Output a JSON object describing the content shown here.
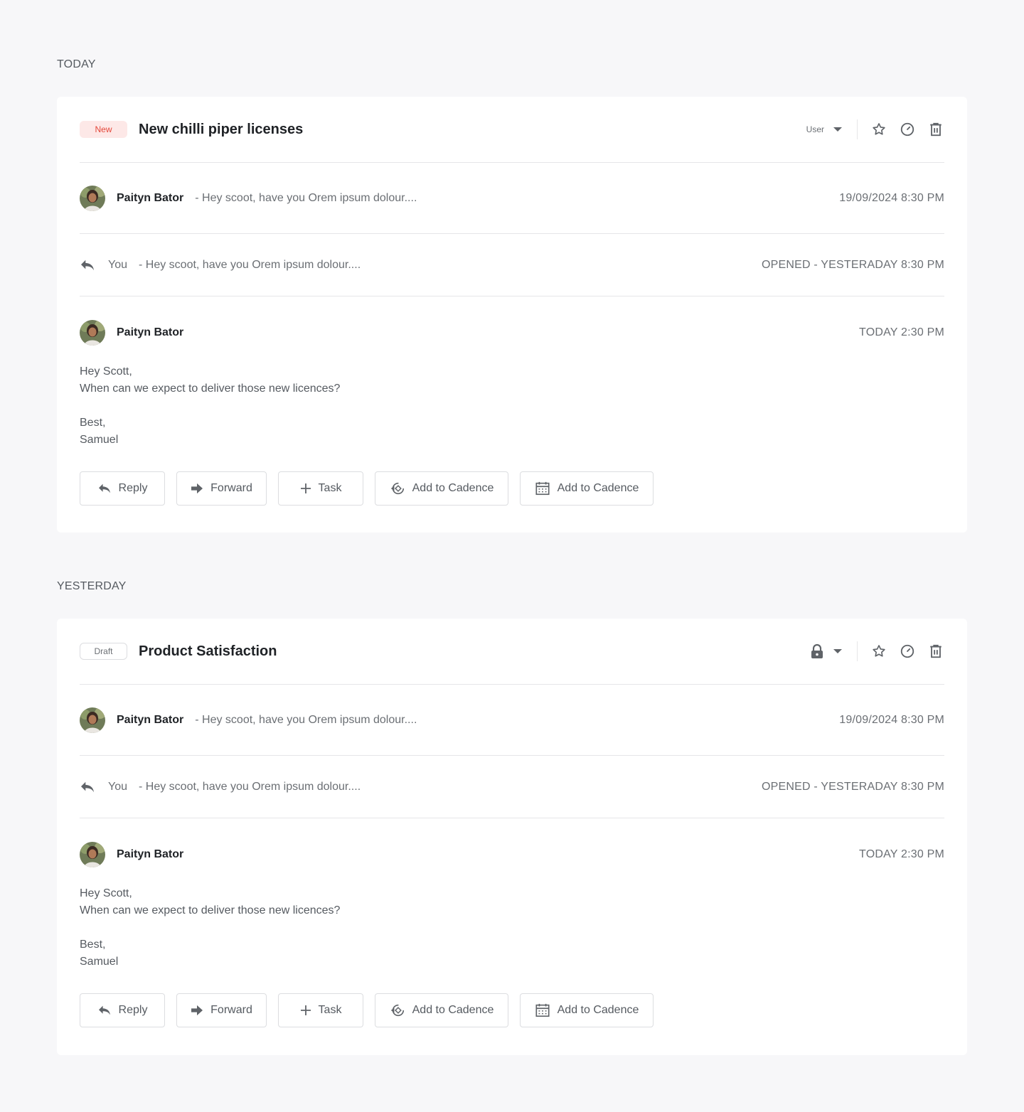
{
  "groups": [
    {
      "label": "TODAY",
      "thread": {
        "badge": "New",
        "title": "New chilli piper licenses",
        "owner_label": "User",
        "collapsed": {
          "sender": "Paityn Bator",
          "snippet": "- Hey scoot, have you Orem ipsum dolour....",
          "time": "19/09/2024 8:30 PM"
        },
        "reply": {
          "author": "You",
          "snippet": "- Hey scoot, have you Orem ipsum dolour....",
          "status": "OPENED - YESTERADAY 8:30 PM"
        },
        "open": {
          "sender": "Paityn Bator",
          "time": "TODAY 2:30 PM",
          "greeting": "Hey Scott,",
          "line": "When can we expect to deliver those new licences?",
          "signoff": "Best,",
          "signature": "Samuel"
        }
      }
    },
    {
      "label": "YESTERDAY",
      "thread": {
        "badge": "Draft",
        "title": "Product Satisfaction",
        "owner_label": "",
        "collapsed": {
          "sender": "Paityn Bator",
          "snippet": "- Hey scoot, have you Orem ipsum dolour....",
          "time": "19/09/2024 8:30 PM"
        },
        "reply": {
          "author": "You",
          "snippet": "- Hey scoot, have you Orem ipsum dolour....",
          "status": "OPENED - YESTERADAY 8:30 PM"
        },
        "open": {
          "sender": "Paityn Bator",
          "time": "TODAY 2:30 PM",
          "greeting": "Hey Scott,",
          "line": "When can we expect to deliver those new licences?",
          "signoff": "Best,",
          "signature": "Samuel"
        }
      }
    }
  ],
  "actions": {
    "reply": "Reply",
    "forward": "Forward",
    "task": "Task",
    "add_to_cadence_1": "Add to Cadence",
    "add_to_cadence_2": "Add to Cadence"
  },
  "icons": {
    "owner_caret": "caret-down-icon",
    "lock": "lock-icon",
    "star": "star-icon",
    "snooze": "clock-icon",
    "delete": "trash-icon",
    "reply": "reply-icon",
    "forward": "forward-icon",
    "task": "plus-icon",
    "cadence": "cadence-icon",
    "calendar": "calendar-icon"
  },
  "colors": {
    "new_badge_bg": "#fde8e7",
    "new_badge_text": "#e4473a",
    "background": "#f7f7f9",
    "card": "#ffffff"
  }
}
